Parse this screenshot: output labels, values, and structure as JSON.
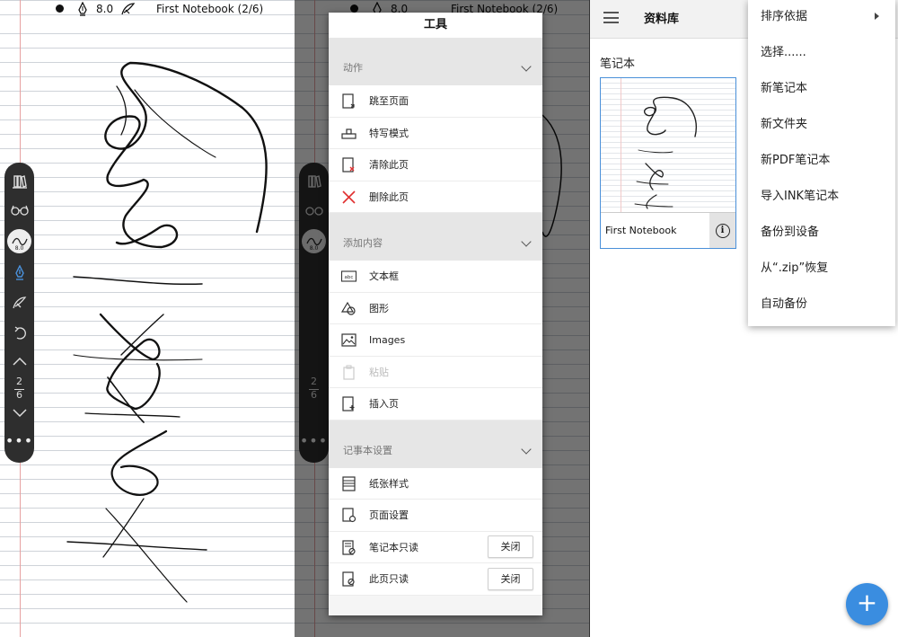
{
  "notebook_view": {
    "pen_size": "8.0",
    "title": "First Notebook (2/6)",
    "current_page": "2",
    "total_pages": "6",
    "pen_circle_size": "8.0",
    "more": "•••"
  },
  "tools_dialog": {
    "title": "工具",
    "sections": [
      {
        "label": "动作",
        "items": [
          {
            "label": "跳至页面",
            "icon": "goto-page-icon"
          },
          {
            "label": "特写模式",
            "icon": "closeup-icon"
          },
          {
            "label": "清除此页",
            "icon": "clear-page-icon"
          },
          {
            "label": "删除此页",
            "icon": "delete-icon"
          }
        ]
      },
      {
        "label": "添加内容",
        "items": [
          {
            "label": "文本框",
            "icon": "textbox-icon"
          },
          {
            "label": "图形",
            "icon": "shapes-icon"
          },
          {
            "label": "Images",
            "icon": "image-icon"
          },
          {
            "label": "粘贴",
            "icon": "paste-icon",
            "disabled": true
          },
          {
            "label": "插入页",
            "icon": "insert-page-icon"
          }
        ]
      },
      {
        "label": "记事本设置",
        "items": [
          {
            "label": "纸张样式",
            "icon": "paper-style-icon"
          },
          {
            "label": "页面设置",
            "icon": "page-settings-icon"
          },
          {
            "label": "笔记本只读",
            "icon": "notebook-readonly-icon",
            "toggle": "关闭"
          },
          {
            "label": "此页只读",
            "icon": "page-readonly-icon",
            "toggle": "关闭"
          }
        ]
      }
    ]
  },
  "library": {
    "title": "资料库",
    "section": "笔记本",
    "notebook_name": "First Notebook",
    "info": "i",
    "menu": [
      {
        "label": "排序依据",
        "submenu": true
      },
      {
        "label": "选择......"
      },
      {
        "label": "新笔记本"
      },
      {
        "label": "新文件夹"
      },
      {
        "label": "新PDF笔记本"
      },
      {
        "label": "导入INK笔记本"
      },
      {
        "label": "备份到设备"
      },
      {
        "label": "从“.zip”恢复"
      },
      {
        "label": "自动备份"
      }
    ],
    "fab": "+",
    "accent_color": "#3a8de0"
  }
}
